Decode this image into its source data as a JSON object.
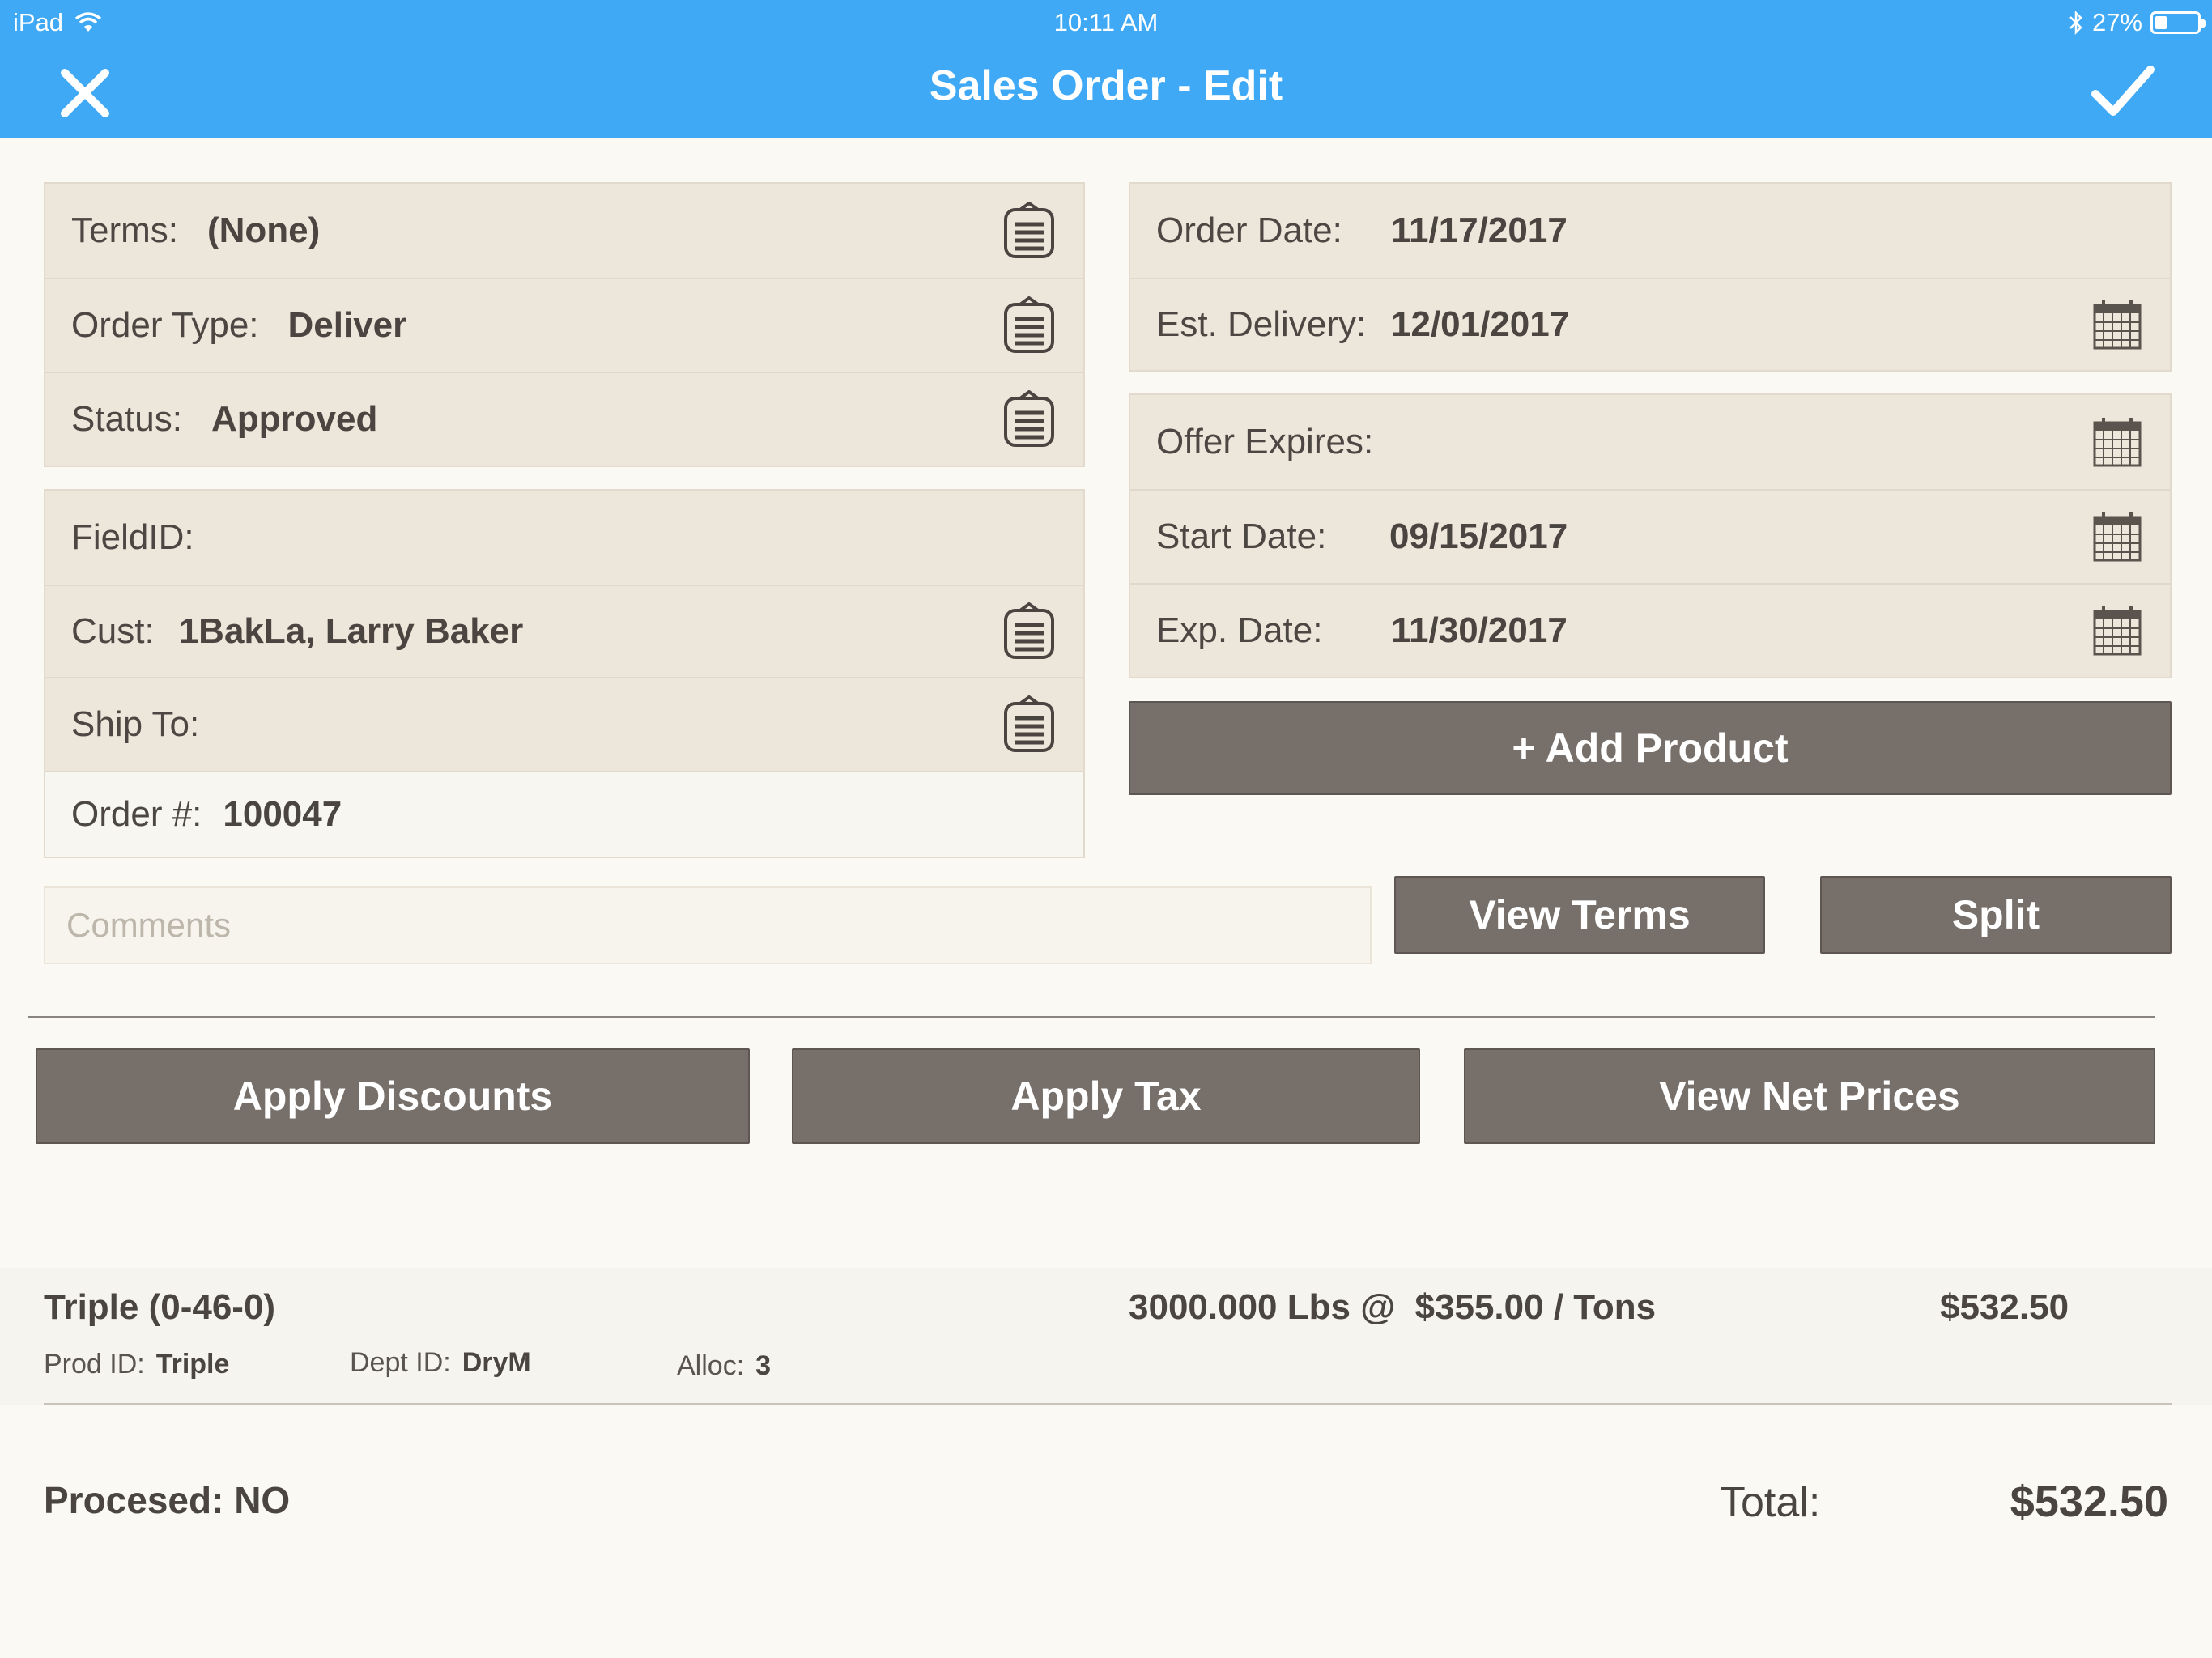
{
  "statusbar": {
    "device": "iPad",
    "time": "10:11 AM",
    "battery": "27%"
  },
  "header": {
    "title": "Sales Order - Edit",
    "close_icon": "close-icon",
    "done_icon": "checkmark-icon"
  },
  "left_panel_top": {
    "terms_label": "Terms:",
    "terms_value": "(None)",
    "order_type_label": "Order Type:",
    "order_type_value": "Deliver",
    "status_label": "Status:",
    "status_value": "Approved"
  },
  "left_panel_bottom": {
    "field_id_label": "FieldID:",
    "cust_label": "Cust:",
    "cust_value": "1BakLa, Larry Baker",
    "ship_to_label": "Ship To:",
    "order_no_label": "Order #:",
    "order_no_value": "100047"
  },
  "right_panel_top": {
    "order_date_label": "Order Date:",
    "order_date_value": "11/17/2017",
    "est_delivery_label": "Est. Delivery:",
    "est_delivery_value": "12/01/2017"
  },
  "right_panel_bottom": {
    "offer_expires_label": "Offer Expires:",
    "start_date_label": "Start Date:",
    "start_date_value": "09/15/2017",
    "exp_date_label": "Exp. Date:",
    "exp_date_value": "11/30/2017"
  },
  "buttons": {
    "add_product": "+ Add Product",
    "view_terms": "View Terms",
    "split": "Split",
    "apply_discounts": "Apply Discounts",
    "apply_tax": "Apply Tax",
    "view_net_prices": "View Net Prices"
  },
  "comments": {
    "placeholder": "Comments"
  },
  "line_items": [
    {
      "name": "Triple (0-46-0)",
      "quantity_price": "3000.000 Lbs @  $355.00 / Tons",
      "amount": "$532.50",
      "prod_id_label": "Prod ID:",
      "prod_id": "Triple",
      "dept_id_label": "Dept ID:",
      "dept_id": "DryM",
      "alloc_label": "Alloc:",
      "alloc": "3"
    }
  ],
  "footer": {
    "processed": "Procesed: NO",
    "total_label": "Total:",
    "total_value": "$532.50"
  },
  "colors": {
    "header_blue": "#3fa9f5",
    "button_gray": "#776f69",
    "panel_beige": "#ede6db"
  }
}
